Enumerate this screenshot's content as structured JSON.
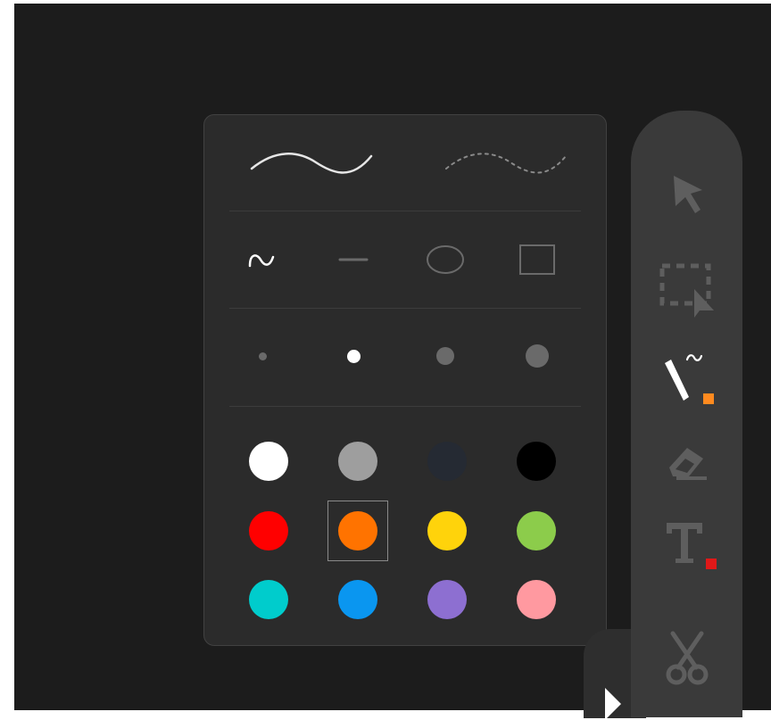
{
  "pen_panel": {
    "stroke_styles": [
      "smooth-stroke",
      "dashed-stroke"
    ],
    "shapes": [
      "freehand",
      "line",
      "ellipse",
      "rectangle"
    ],
    "sizes": [
      "extra-small",
      "small",
      "medium",
      "large"
    ],
    "selected_size": "small",
    "colors": [
      [
        "#ffffff",
        "#9e9e9e",
        "#252a33",
        "#000000"
      ],
      [
        "#ff0000",
        "#ff7300",
        "#ffd30b",
        "#8ccc4b"
      ],
      [
        "#00cccc",
        "#0a96f0",
        "#8d6fd1",
        "#ff99a0"
      ]
    ],
    "selected_color": "#ff7300"
  },
  "toolbar": {
    "tools": [
      "select-tool",
      "lasso-select-tool",
      "pen-tool",
      "eraser-tool",
      "text-tool",
      "scissors-tool"
    ],
    "active_tool": "pen-tool",
    "pen_color": "#ff7300",
    "text_color": "#ff0000"
  }
}
